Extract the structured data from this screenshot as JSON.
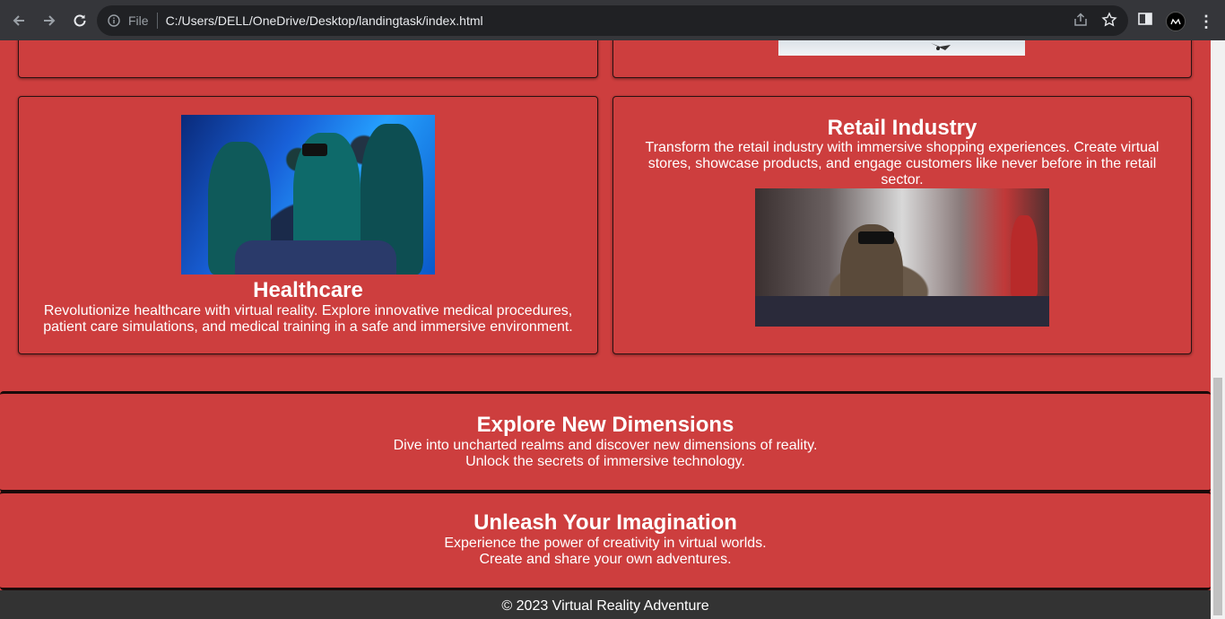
{
  "browser": {
    "scheme_label": "File",
    "url": "C:/Users/DELL/OneDrive/Desktop/landingtask/index.html"
  },
  "cards": {
    "healthcare": {
      "title": "Healthcare",
      "text": "Revolutionize healthcare with virtual reality. Explore innovative medical procedures, patient care simulations, and medical training in a safe and immersive environment."
    },
    "retail": {
      "title": "Retail Industry",
      "text": "Transform the retail industry with immersive shopping experiences. Create virtual stores, showcase products, and engage customers like never before in the retail sector."
    }
  },
  "sections": {
    "explore": {
      "title": "Explore New Dimensions",
      "line1": "Dive into uncharted realms and discover new dimensions of reality.",
      "line2": "Unlock the secrets of immersive technology."
    },
    "unleash": {
      "title": "Unleash Your Imagination",
      "line1": "Experience the power of creativity in virtual worlds.",
      "line2": "Create and share your own adventures."
    }
  },
  "footer": {
    "text": "© 2023 Virtual Reality Adventure"
  },
  "colors": {
    "page_bg": "#cd3e3e",
    "footer_bg": "#333333",
    "chrome_bg": "#35363a"
  }
}
